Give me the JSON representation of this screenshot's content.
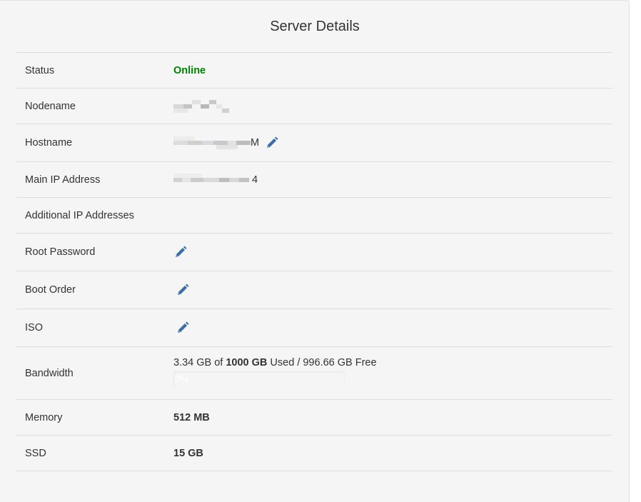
{
  "panel": {
    "title": "Server Details"
  },
  "rows": {
    "status": {
      "label": "Status",
      "value": "Online"
    },
    "nodename": {
      "label": "Nodename"
    },
    "hostname": {
      "label": "Hostname",
      "suffix": "M"
    },
    "main_ip": {
      "label": "Main IP Address",
      "suffix": "4"
    },
    "additional_ips": {
      "label": "Additional IP Addresses"
    },
    "root_password": {
      "label": "Root Password"
    },
    "boot_order": {
      "label": "Boot Order"
    },
    "iso": {
      "label": "ISO"
    },
    "bandwidth": {
      "label": "Bandwidth",
      "used": "3.34 GB",
      "of_text": " of ",
      "total": "1000 GB",
      "rest_text": " Used / 996.66 GB Free",
      "percent_label": "0%",
      "fraction_used": 0.0033
    },
    "memory": {
      "label": "Memory",
      "value": "512 MB"
    },
    "ssd": {
      "label": "SSD",
      "value": "15 GB"
    }
  },
  "colors": {
    "online": "#008000",
    "icon": "#3a6ea5"
  },
  "icons": {
    "edit": "pencil-icon"
  }
}
